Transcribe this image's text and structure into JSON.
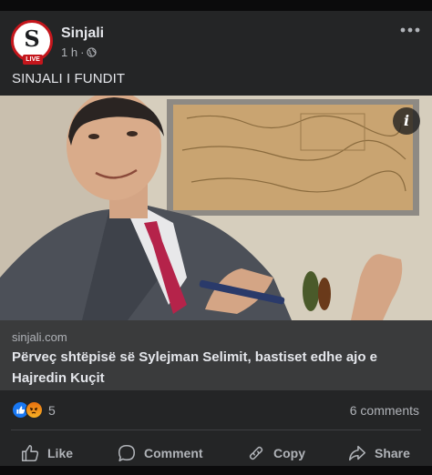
{
  "post": {
    "page_name": "Sinjali",
    "avatar_letter": "S",
    "avatar_badge": "LIVE",
    "time": "1 h",
    "separator": "·",
    "text": "SINJALI I FUNDIT"
  },
  "link": {
    "domain": "sinjali.com",
    "title": "Përveç shtëpisë së Sylejman Selimit, bastiset edhe ajo e Hajredin Kuçit"
  },
  "stats": {
    "reaction_count": "5",
    "comments": "6 comments"
  },
  "actions": {
    "like": "Like",
    "comment": "Comment",
    "copy": "Copy",
    "share": "Share"
  },
  "icons": {
    "photo_info": "i"
  },
  "colors": {
    "brand_red": "#c4161c",
    "like_blue": "#1877f2",
    "card_bg": "#242526",
    "link_bg": "#3a3b3c"
  }
}
